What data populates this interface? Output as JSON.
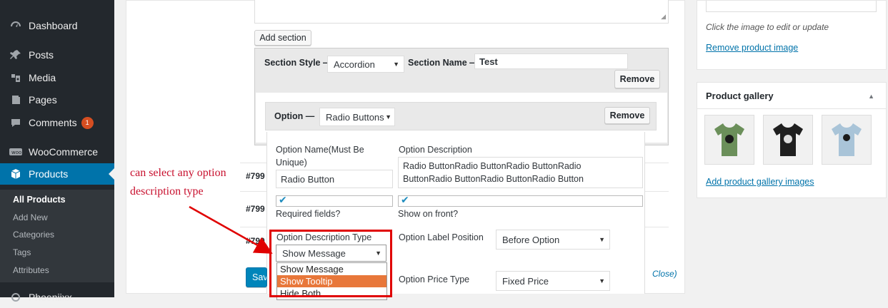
{
  "sidebar": {
    "items": [
      {
        "label": "Dashboard",
        "icon": "dashboard-icon"
      },
      {
        "label": "Posts",
        "icon": "pin-icon"
      },
      {
        "label": "Media",
        "icon": "media-icon"
      },
      {
        "label": "Pages",
        "icon": "page-icon"
      },
      {
        "label": "Comments",
        "icon": "comment-icon",
        "badge": "1"
      },
      {
        "label": "WooCommerce",
        "icon": "woocommerce-icon"
      },
      {
        "label": "Products",
        "icon": "products-icon"
      },
      {
        "label": "Phoeniixx",
        "icon": "plugin-icon"
      }
    ],
    "submenu": [
      "All Products",
      "Add New",
      "Categories",
      "Tags",
      "Attributes"
    ]
  },
  "editor": {
    "add_section_label": "Add section",
    "section_style_label": "Section Style —",
    "section_style_value": "Accordion",
    "section_name_label": "Section Name —",
    "section_name_value": "Test",
    "remove_label": "Remove",
    "option_label": "Option —",
    "option_type_value": "Radio Buttons",
    "option_remove_label": "Remove",
    "option_name_label_1": "Option Name(Must Be",
    "option_name_label_2": "Unique)",
    "option_name_value": "Radio Button",
    "option_desc_label": "Option Description",
    "option_desc_line1": "Radio ButtonRadio ButtonRadio ButtonRadio",
    "option_desc_line2": "ButtonRadio ButtonRadio ButtonRadio Button",
    "required_label": "Required fields?",
    "show_front_label": "Show on front?",
    "desc_type_label": "Option Description Type",
    "desc_type_value": "Show Message",
    "desc_type_options": [
      "Show Message",
      "Show Tooltip",
      "Hide Both"
    ],
    "label_position_label": "Option Label Position",
    "label_position_value": "Before Option",
    "price_type_label": "Option Price Type",
    "price_type_value": "Fixed Price",
    "close_link": "Close)",
    "save_label": "Sav"
  },
  "rows": [
    {
      "id": "#799"
    },
    {
      "id": "#799"
    },
    {
      "id": "#799"
    }
  ],
  "annotation": {
    "line1": "can select any option",
    "line2": "description type"
  },
  "product_image": {
    "hint": "Click the image to edit or update",
    "remove_link": "Remove product image"
  },
  "gallery": {
    "title": "Product gallery",
    "add_link": "Add product gallery images",
    "shirts": [
      {
        "color": "#6b8f5a"
      },
      {
        "color": "#1f1f1f"
      },
      {
        "color": "#a9c4d8"
      }
    ]
  },
  "colors": {
    "accent": "#0073aa",
    "highlight": "#e8773a",
    "annotation_red": "#e00000"
  }
}
